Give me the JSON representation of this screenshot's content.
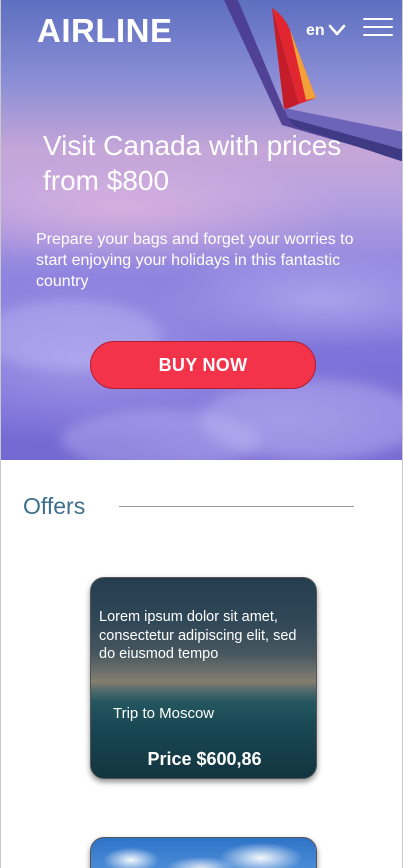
{
  "header": {
    "logo": "AIRLINE",
    "language": "en",
    "menu_icon": "hamburger-menu-icon",
    "language_icon": "chevron-down-icon"
  },
  "hero": {
    "title": "Visit Canada with prices from $800",
    "subtitle": "Prepare your bags and forget your worries to start enjoying your holidays in this fantastic country",
    "cta_label": "BUY NOW"
  },
  "offers": {
    "heading": "Offers",
    "cards": [
      {
        "description": "Lorem ipsum dolor sit amet, consectetur adipiscing elit, sed do eiusmod tempo",
        "trip": "Trip to Moscow",
        "price": "Price $600,86"
      }
    ]
  },
  "colors": {
    "cta": "#f2334a",
    "offers_heading": "#3d6f8c",
    "text_light": "#ffffff"
  }
}
